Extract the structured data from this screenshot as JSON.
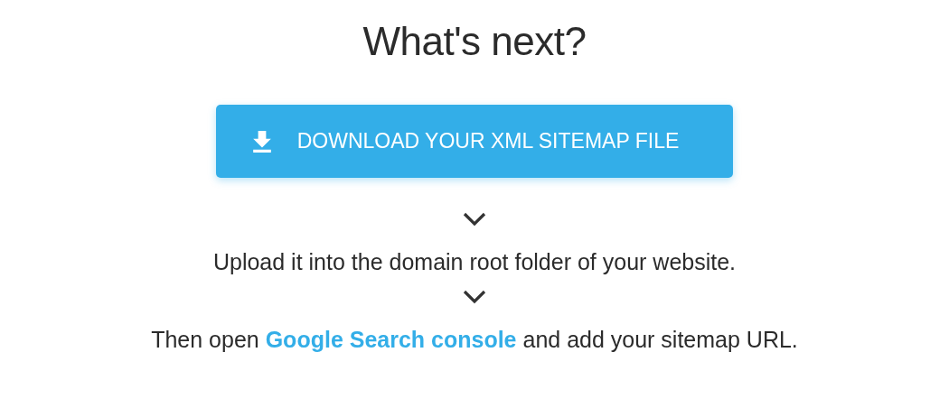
{
  "heading": "What's next?",
  "download_button": {
    "label": "DOWNLOAD YOUR XML SITEMAP FILE"
  },
  "steps": [
    {
      "kind": "text",
      "text": "Upload it into the domain root folder of your website."
    },
    {
      "kind": "link",
      "text_before": "Then open",
      "link": "Google Search console",
      "text_after": "and add your sitemap URL."
    }
  ]
}
